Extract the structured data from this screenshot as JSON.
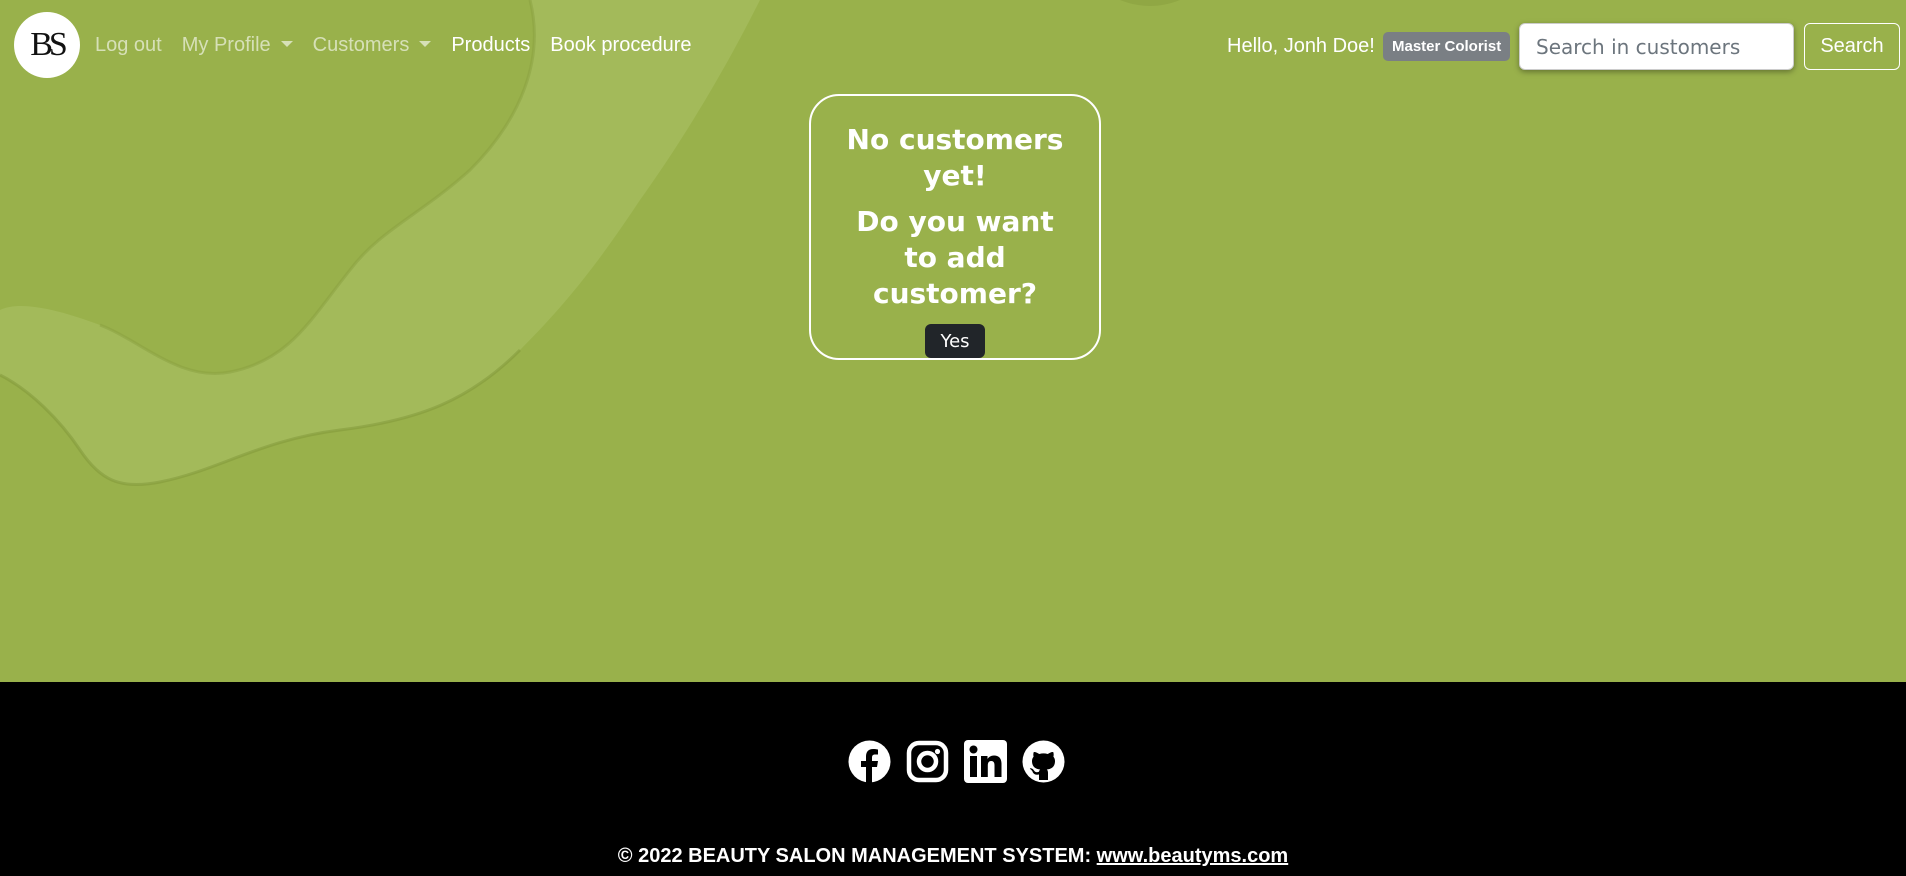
{
  "navbar": {
    "logo_text": "BS",
    "links": [
      {
        "label": "Log out"
      },
      {
        "label": "My Profile"
      },
      {
        "label": "Customers"
      },
      {
        "label": "Products"
      },
      {
        "label": "Book procedure"
      }
    ],
    "greeting": "Hello, Jonh Doe!",
    "role_badge": "Master Colorist",
    "search": {
      "placeholder": "Search in customers",
      "value": "",
      "button_label": "Search"
    }
  },
  "main": {
    "empty_title": "No customers yet!",
    "empty_prompt": "Do you want to add customer?",
    "yes_label": "Yes"
  },
  "footer": {
    "social_icons": [
      "facebook-icon",
      "instagram-icon",
      "linkedin-icon",
      "github-icon"
    ],
    "copyright_text": "© 2022 BEAUTY SALON MANAGEMENT SYSTEM: ",
    "site_link": "www.beautyms.com"
  },
  "colors": {
    "background": "#99b14b",
    "footer": "#000000",
    "badge": "#7a7f84",
    "button_dark": "#212529"
  }
}
